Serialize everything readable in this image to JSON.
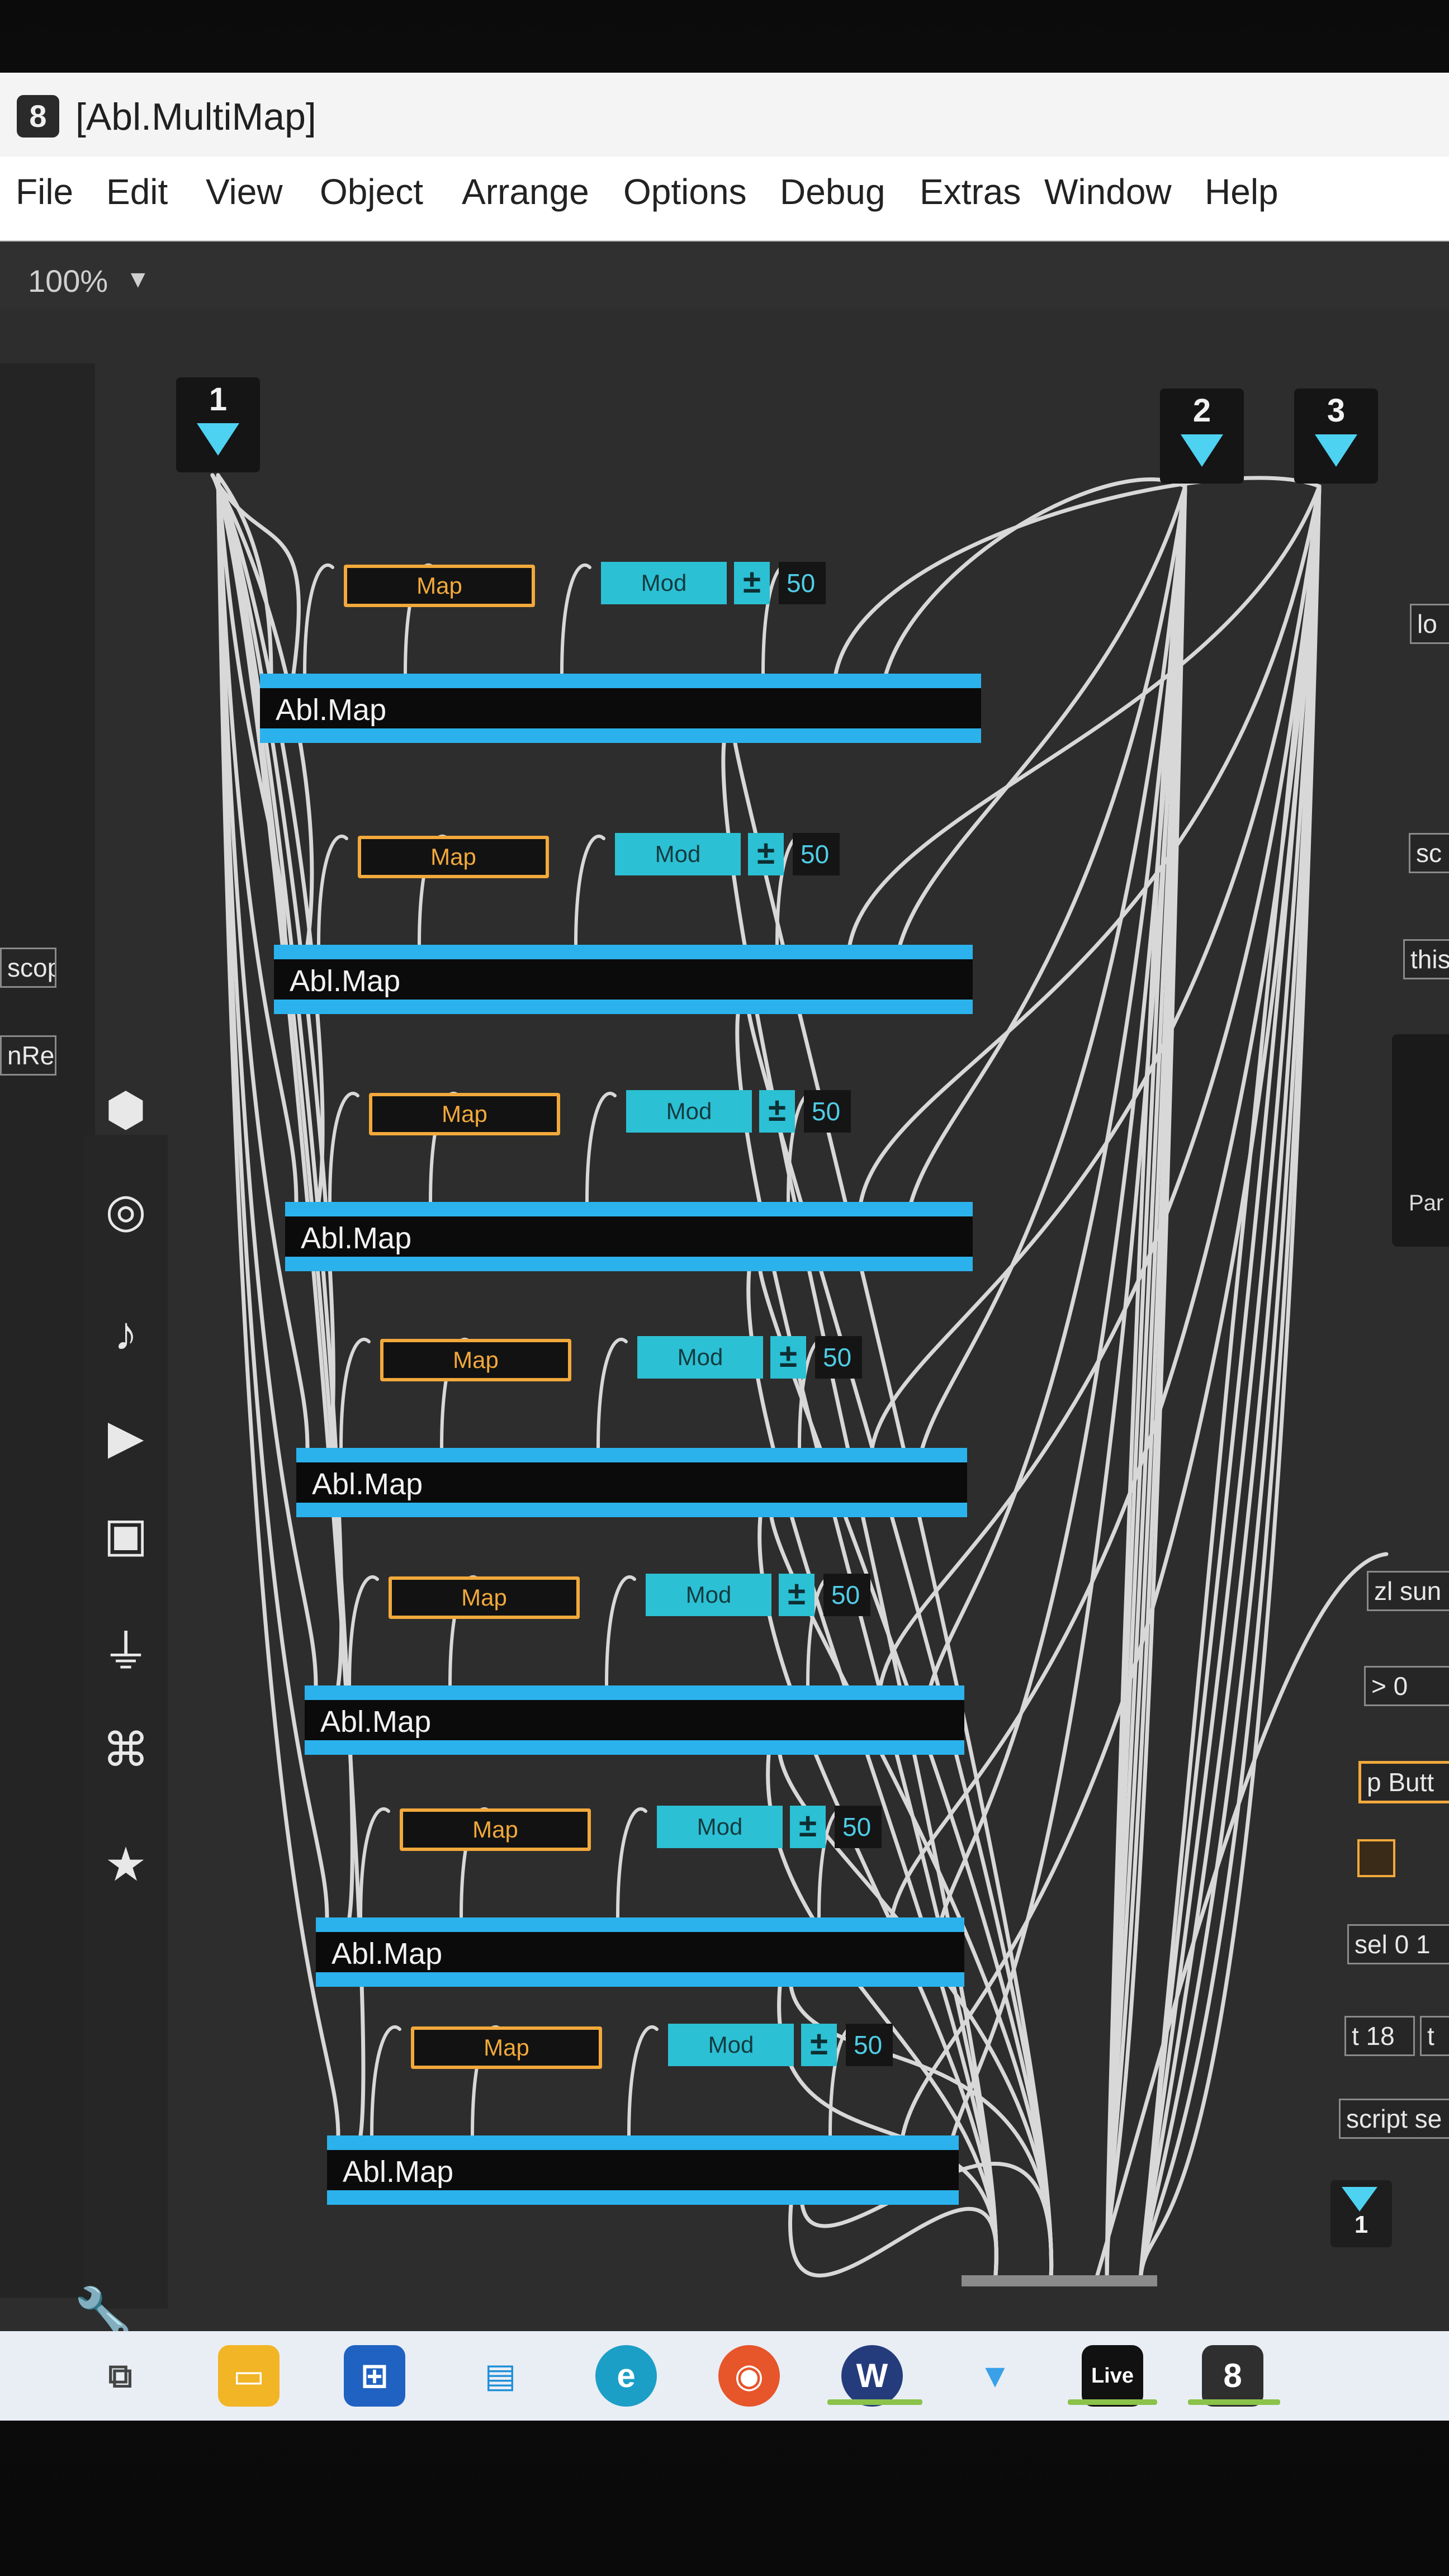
{
  "window": {
    "title": "[Abl.MultiMap]"
  },
  "menu": [
    "File",
    "Edit",
    "View",
    "Object",
    "Arrange",
    "Options",
    "Debug",
    "Extras",
    "Window",
    "Help"
  ],
  "toolbar": {
    "zoom": "100%"
  },
  "inlets": [
    "1",
    "2",
    "3"
  ],
  "map_rows": [
    {
      "object": "Abl.Map",
      "map_label": "Map",
      "mod_label": "Mod",
      "plus_label": "±",
      "number": "50"
    },
    {
      "object": "Abl.Map",
      "map_label": "Map",
      "mod_label": "Mod",
      "plus_label": "±",
      "number": "50"
    },
    {
      "object": "Abl.Map",
      "map_label": "Map",
      "mod_label": "Mod",
      "plus_label": "±",
      "number": "50"
    },
    {
      "object": "Abl.Map",
      "map_label": "Map",
      "mod_label": "Mod",
      "plus_label": "±",
      "number": "50"
    },
    {
      "object": "Abl.Map",
      "map_label": "Map",
      "mod_label": "Mod",
      "plus_label": "±",
      "number": "50"
    },
    {
      "object": "Abl.Map",
      "map_label": "Map",
      "mod_label": "Mod",
      "plus_label": "±",
      "number": "50"
    },
    {
      "object": "Abl.Map",
      "map_label": "Map",
      "mod_label": "Mod",
      "plus_label": "±",
      "number": "50"
    }
  ],
  "right_objects": {
    "lo": "lo",
    "sc": "sc",
    "this": "this",
    "panel": "Par",
    "zl": "zl sun",
    "gt": "> 0",
    "pbutton": "p Butt",
    "sel": "sel 0 1",
    "t18": "t 18",
    "t2": "t",
    "script": "script se",
    "outlet": "1"
  },
  "left_objects": {
    "scope": "scope",
    "nre": "nRe"
  },
  "sidebar_icons": [
    "cube-icon",
    "target-icon",
    "music-note-icon",
    "media-icon",
    "image-icon",
    "plug-icon",
    "clip-icon",
    "star-icon",
    "wrench-icon"
  ],
  "taskbar_icons": [
    "task-view-icon",
    "file-explorer-icon",
    "store-icon",
    "remote-desktop-icon",
    "edge-icon",
    "firefox-icon",
    "wavebox-icon",
    "vpn-icon",
    "ableton-live-icon",
    "max-icon"
  ],
  "taskbar_labels": {
    "live": "Live"
  },
  "colors": {
    "accent_blue": "#2bb2ec",
    "map_orange": "#f2a93b",
    "mod_cyan": "#2cc0d4",
    "patch_bg": "#2d2d2d",
    "cable": "#d8d8d8"
  }
}
